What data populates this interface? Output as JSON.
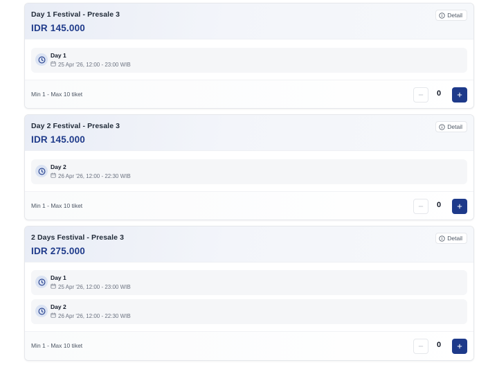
{
  "tickets": [
    {
      "title": "Day 1 Festival - Presale 3",
      "price": "IDR 145.000",
      "detail_label": "Detail",
      "sessions": [
        {
          "day": "Day 1",
          "date": "25 Apr '26, 12:00 - 23:00 WIB"
        }
      ],
      "limit": "Min 1 - Max 10 tiket",
      "quantity": "0"
    },
    {
      "title": "Day 2 Festival - Presale 3",
      "price": "IDR 145.000",
      "detail_label": "Detail",
      "sessions": [
        {
          "day": "Day 2",
          "date": "26 Apr '26, 12:00 - 22:30 WIB"
        }
      ],
      "limit": "Min 1 - Max 10 tiket",
      "quantity": "0"
    },
    {
      "title": "2 Days Festival - Presale 3",
      "price": "IDR 275.000",
      "detail_label": "Detail",
      "sessions": [
        {
          "day": "Day 1",
          "date": "25 Apr '26, 12:00 - 23:00 WIB"
        },
        {
          "day": "Day 2",
          "date": "26 Apr '26, 12:00 - 22:30 WIB"
        }
      ],
      "limit": "Min 1 - Max 10 tiket",
      "quantity": "0"
    }
  ],
  "icons": {
    "info": "info-icon",
    "clock": "clock-icon",
    "calendar": "calendar-icon",
    "minus": "minus-icon",
    "plus": "plus-icon"
  },
  "colors": {
    "accent": "#1e3a8a",
    "header_bg": "#eef1f7",
    "session_bg": "#f5f6f8"
  }
}
